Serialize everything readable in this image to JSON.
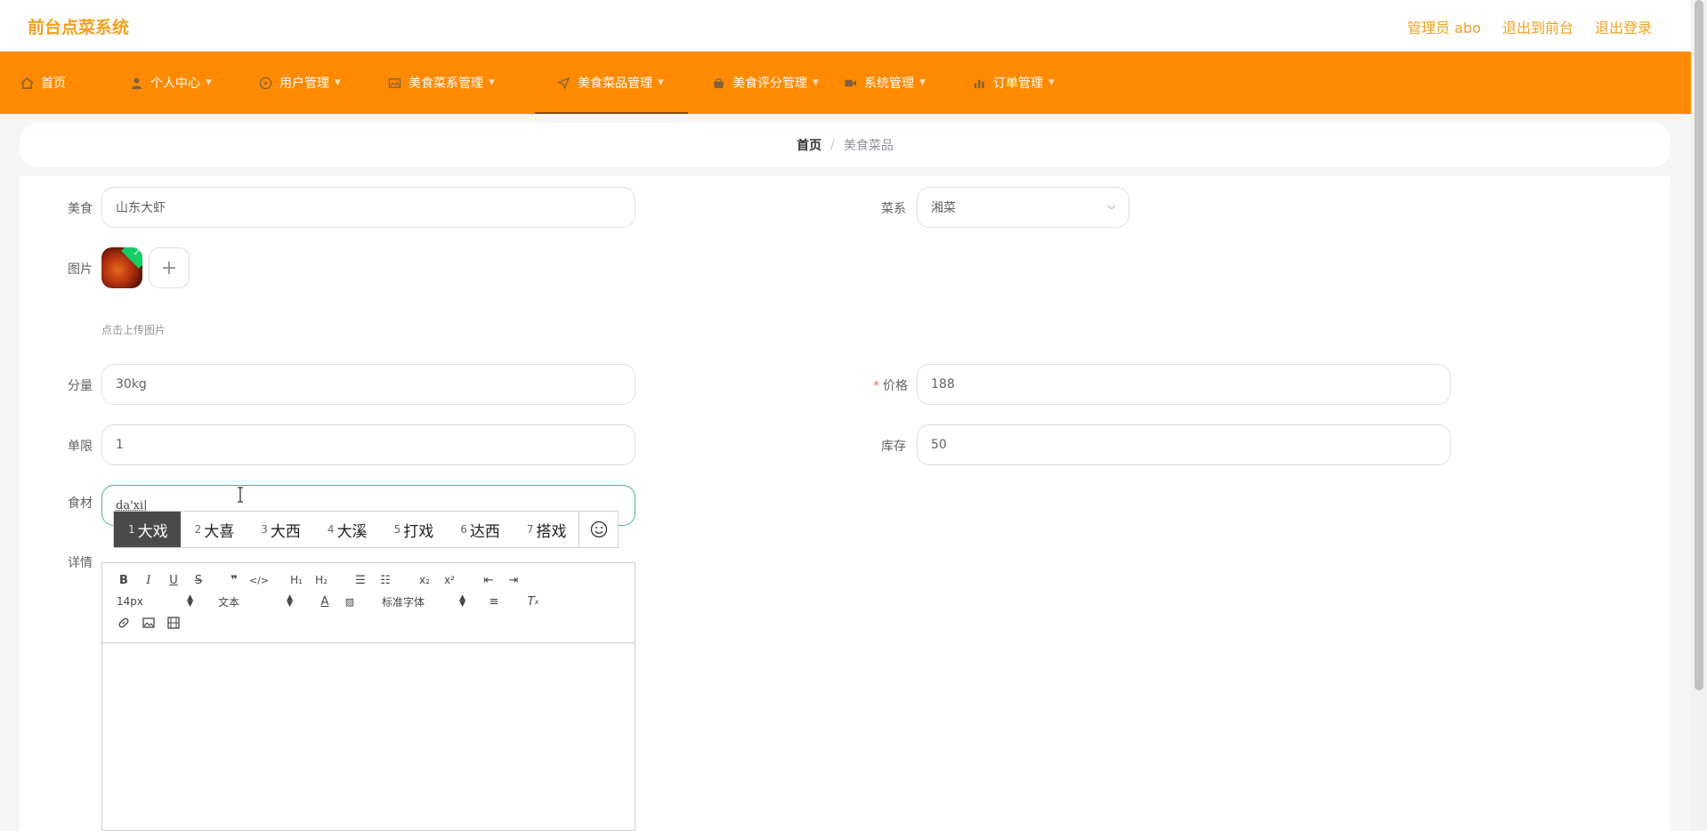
{
  "header": {
    "brand": "前台点菜系统",
    "links": [
      "管理员 abo",
      "退出到前台",
      "退出登录"
    ]
  },
  "nav": {
    "items": [
      {
        "label": "首页",
        "icon": "home-icon",
        "caret": false
      },
      {
        "label": "个人中心",
        "icon": "user-icon",
        "caret": true
      },
      {
        "label": "用户管理",
        "icon": "compass-icon",
        "caret": true
      },
      {
        "label": "美食菜系管理",
        "icon": "picture-icon",
        "caret": true
      },
      {
        "label": "美食菜品管理",
        "icon": "send-icon",
        "caret": true,
        "active": true
      },
      {
        "label": "美食评分管理",
        "icon": "goods-icon",
        "caret": true
      },
      {
        "label": "系统管理",
        "icon": "video-icon",
        "caret": true
      },
      {
        "label": "订单管理",
        "icon": "chart-icon",
        "caret": true
      }
    ]
  },
  "breadcrumb": {
    "home": "首页",
    "current": "美食菜品"
  },
  "form": {
    "food": {
      "label": "美食",
      "value": "山东大虾"
    },
    "cuisine": {
      "label": "菜系",
      "value": "湘菜"
    },
    "image": {
      "label": "图片",
      "hint": "点击上传图片"
    },
    "portion": {
      "label": "分量",
      "value": "30kg"
    },
    "price": {
      "label": "价格",
      "value": "188",
      "required": true
    },
    "limit": {
      "label": "单限",
      "value": "1"
    },
    "stock": {
      "label": "库存",
      "value": "50"
    },
    "ingredients": {
      "label": "食材",
      "value": "da'xi|"
    },
    "detail": {
      "label": "详情"
    }
  },
  "ime": {
    "candidates": [
      {
        "n": "1",
        "text": "大戏"
      },
      {
        "n": "2",
        "text": "大喜"
      },
      {
        "n": "3",
        "text": "大西"
      },
      {
        "n": "4",
        "text": "大溪"
      },
      {
        "n": "5",
        "text": "打戏"
      },
      {
        "n": "6",
        "text": "达西"
      },
      {
        "n": "7",
        "text": "搭戏"
      }
    ]
  },
  "editor": {
    "font_size": "14px",
    "header_select": "文本",
    "font_family": "标准字体"
  },
  "colors": {
    "accent": "#ff8a00",
    "brand": "#f0a020",
    "focus": "#4cb39a"
  }
}
